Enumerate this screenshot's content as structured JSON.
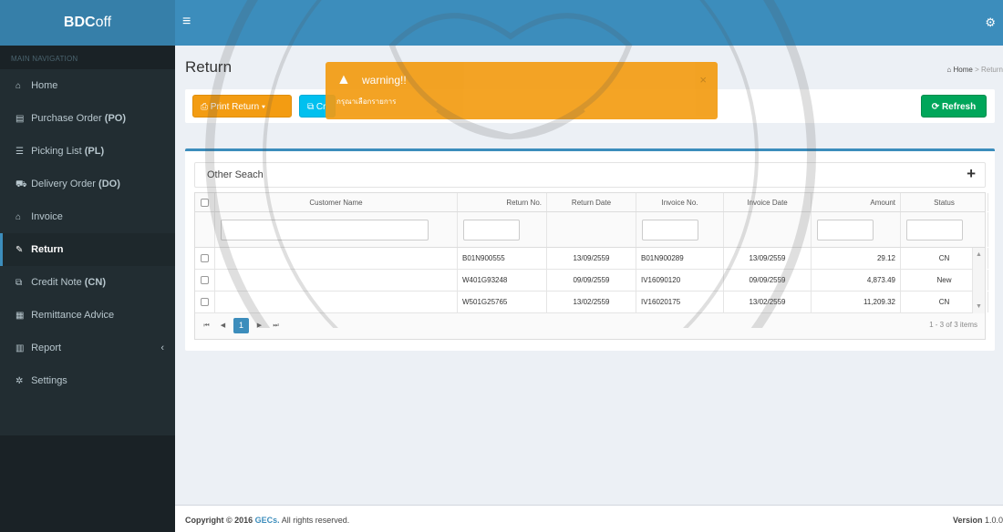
{
  "brand": {
    "bold": "BDC",
    "rest": "off"
  },
  "sidebar": {
    "header": "MAIN NAVIGATION",
    "items": [
      {
        "icon": "⌂",
        "label": "Home",
        "code": ""
      },
      {
        "icon": "▤",
        "label": "Purchase Order",
        "code": "(PO)"
      },
      {
        "icon": "☰",
        "label": "Picking List",
        "code": "(PL)"
      },
      {
        "icon": "⛟",
        "label": "Delivery Order",
        "code": "(DO)"
      },
      {
        "icon": "⌂",
        "label": "Invoice",
        "code": ""
      },
      {
        "icon": "✎",
        "label": "Return",
        "code": ""
      },
      {
        "icon": "⧉",
        "label": "Credit Note",
        "code": "(CN)"
      },
      {
        "icon": "▦",
        "label": "Remittance Advice",
        "code": ""
      },
      {
        "icon": "▥",
        "label": "Report",
        "code": ""
      },
      {
        "icon": "✲",
        "label": "Settings",
        "code": ""
      }
    ]
  },
  "page": {
    "title": "Return"
  },
  "breadcrumb": {
    "home": "Home",
    "sep": ">",
    "current": "Return"
  },
  "toolbar": {
    "print_label": "Print Return",
    "credit_label": "Cr",
    "refresh_label": "Refresh"
  },
  "alert": {
    "title": "warning!!",
    "message": "กรุณาเลือกรายการ",
    "close": "×"
  },
  "panel": {
    "title": "Other Seach"
  },
  "table": {
    "columns": [
      "Customer Name",
      "Return No.",
      "Return Date",
      "Invoice No.",
      "Invoice Date",
      "Amount",
      "Status"
    ],
    "rows": [
      {
        "customer": "",
        "return_no": "B01N900555",
        "return_date": "13/09/2559",
        "invoice_no": "B01N900289",
        "invoice_date": "13/09/2559",
        "amount": "29.12",
        "status": "CN"
      },
      {
        "customer": "",
        "return_no": "W401G93248",
        "return_date": "09/09/2559",
        "invoice_no": "IV16090120",
        "invoice_date": "09/09/2559",
        "amount": "4,873.49",
        "status": "New"
      },
      {
        "customer": "",
        "return_no": "W501G25765",
        "return_date": "13/02/2559",
        "invoice_no": "IV16020175",
        "invoice_date": "13/02/2559",
        "amount": "11,209.32",
        "status": "CN"
      }
    ]
  },
  "pager": {
    "current": "1",
    "info": "1 - 3 of 3 items"
  },
  "footer": {
    "copyright_prefix": "Copyright © 2016",
    "company": "GECs.",
    "suffix": "All rights reserved.",
    "version_label": "Version",
    "version": "1.0.0"
  },
  "colors": {
    "primary": "#3c8dbc",
    "warning": "#f39c12",
    "info": "#00c0ef",
    "success": "#00a65a",
    "sidebar": "#222d32"
  }
}
